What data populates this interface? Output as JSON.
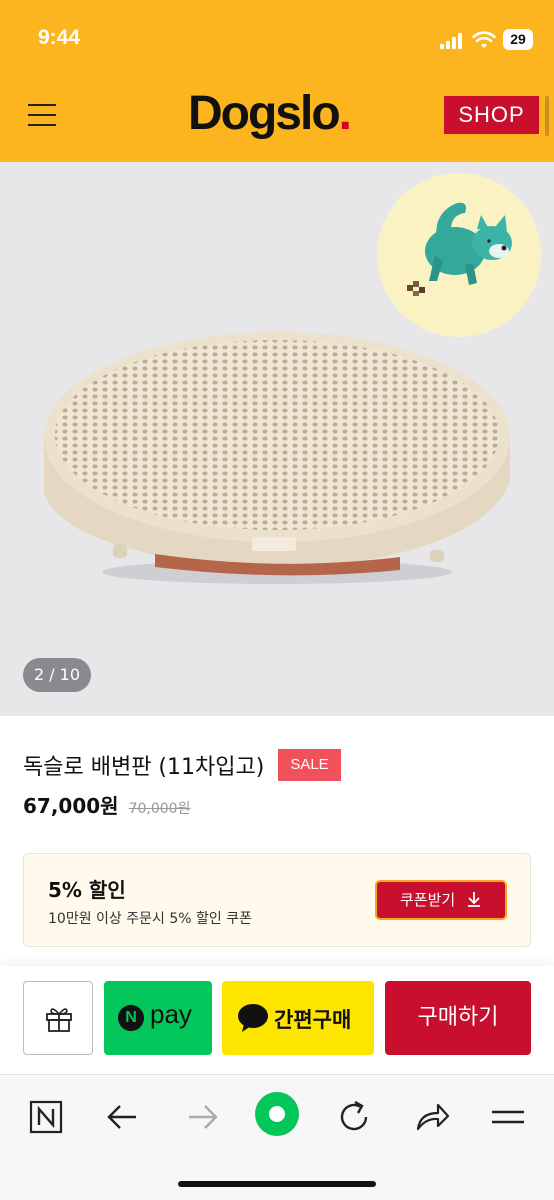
{
  "status_bar": {
    "time": "9:44",
    "battery": "29"
  },
  "header": {
    "logo_text": "Dogslo",
    "logo_dot": ".",
    "shop_label": "SHOP"
  },
  "gallery": {
    "counter": "2 / 10"
  },
  "product": {
    "title": "독슬로 배변판 (11차입고)",
    "sale_badge": "SALE",
    "price": "67,000원",
    "original_price": "70,000원"
  },
  "coupon": {
    "title": "5% 할인",
    "description": "10만원 이상 주문시 5% 할인 쿠폰",
    "button_label": "쿠폰받기"
  },
  "action_bar": {
    "npay_n": "N",
    "npay_label": "pay",
    "kakao_label": "간편구매",
    "buy_label": "구매하기"
  },
  "colors": {
    "header_bg": "#fdb51f",
    "brand_red": "#c8102e",
    "npay_green": "#03c75a",
    "kakao_yellow": "#fee500",
    "sale_badge": "#f0515b"
  },
  "icons": [
    "menu-icon",
    "gift-icon",
    "chat-bubble-icon",
    "download-icon",
    "naver-icon",
    "back-icon",
    "forward-icon",
    "home-dot-icon",
    "reload-icon",
    "share-icon",
    "more-icon"
  ]
}
